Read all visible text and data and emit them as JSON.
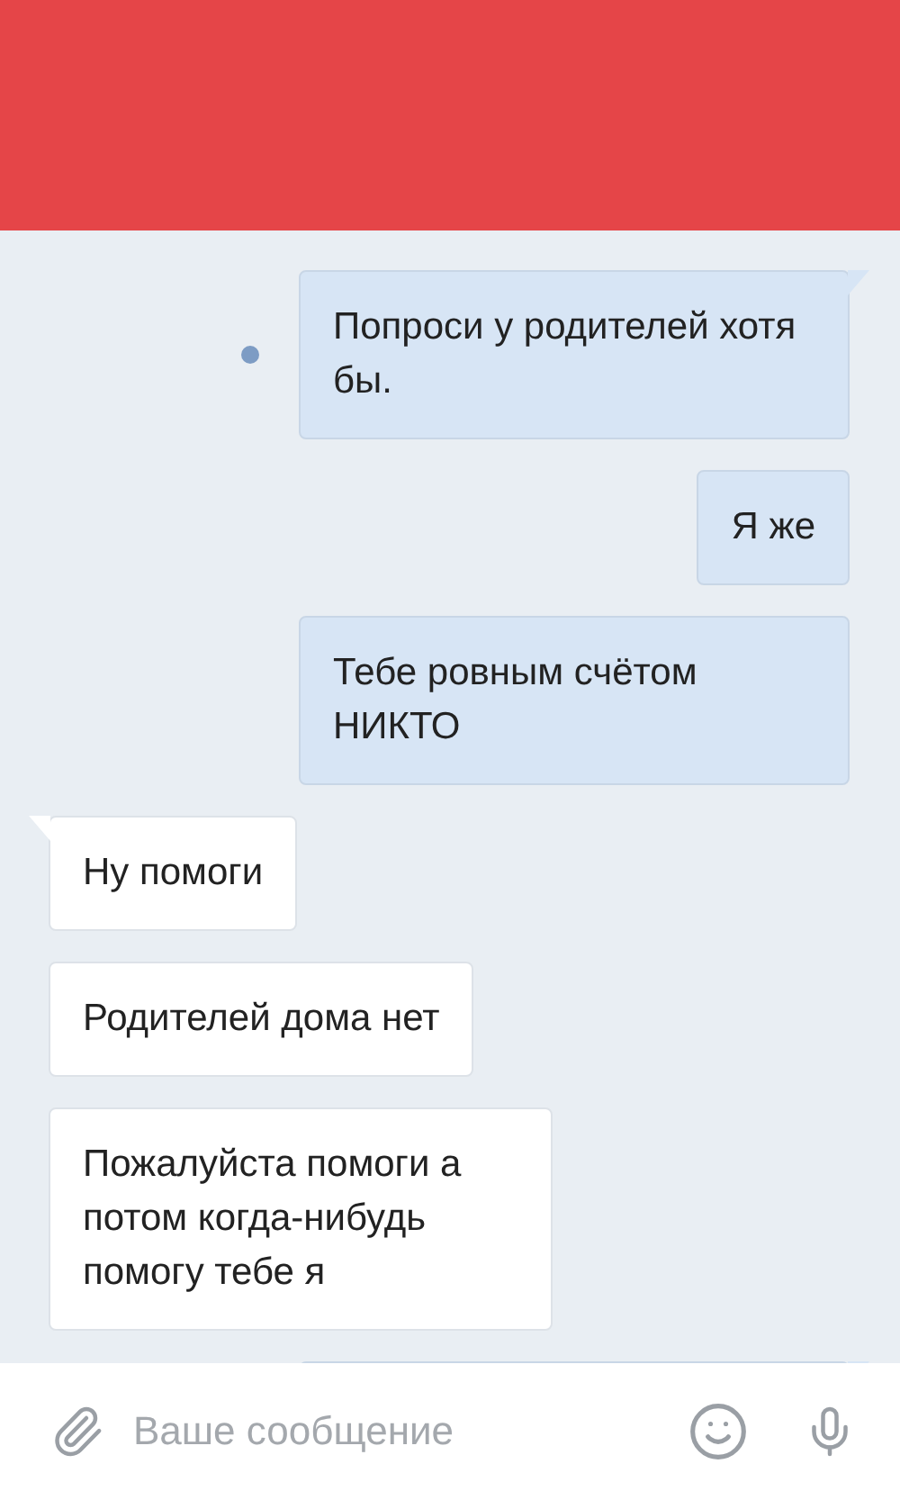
{
  "messages": [
    {
      "kind": "outgoing",
      "text": "Попроси у родителей хотя бы.",
      "unread": true
    },
    {
      "kind": "outgoing",
      "text": "Я же",
      "unread": false
    },
    {
      "kind": "outgoing",
      "text": "Тебе ровным счётом НИКТО",
      "unread": false
    },
    {
      "kind": "incoming",
      "text": "Ну помоги"
    },
    {
      "kind": "incoming",
      "text": "Родителей дома нет"
    },
    {
      "kind": "incoming",
      "text": "Пожалуйста помоги а потом когда-нибудь помогу тебе я"
    },
    {
      "kind": "outgoing",
      "unread": false
    }
  ],
  "composer": {
    "placeholder": "Ваше сообщение"
  }
}
